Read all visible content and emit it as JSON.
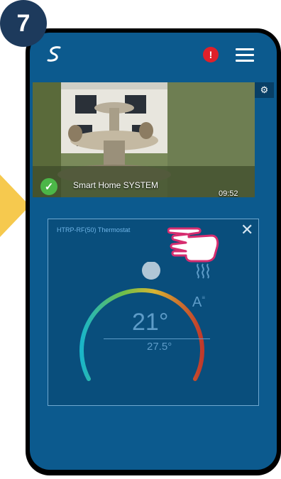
{
  "step": "7",
  "header": {
    "logo_icon": "syxthsense-logo-icon",
    "alert_label": "!",
    "menu_icon": "hamburger-menu-icon"
  },
  "camera": {
    "name": "Smart Home SYSTEM",
    "time": "09:52",
    "status_icon": "check-circle-icon",
    "settings_icon": "gear-icon"
  },
  "thermostat": {
    "title": "HTRP-RF(50) Thermostat",
    "close_label": "✕",
    "current_temp": "21°",
    "set_temp": "27.5°",
    "heating_icon": "heat-waves-icon",
    "mode_label": "A"
  },
  "colors": {
    "screen_bg": "#0c5a8e",
    "accent_blue": "#5e9cc8",
    "alert_red": "#e0202a",
    "status_green": "#4cb648",
    "arrow_yellow": "#f6c94e",
    "hand_outline": "#d62d6f"
  }
}
